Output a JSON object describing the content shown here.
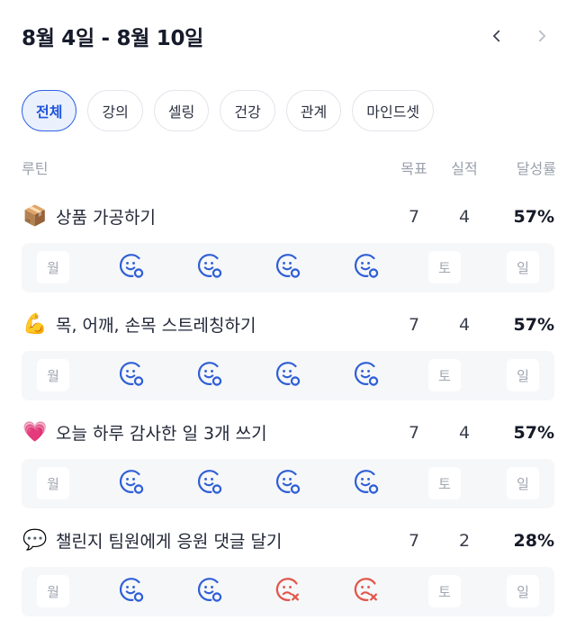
{
  "header": {
    "title": "8월 4일 - 8월 10일"
  },
  "filters": [
    "전체",
    "강의",
    "셀링",
    "건강",
    "관계",
    "마인드셋"
  ],
  "columns": {
    "routine": "루틴",
    "goal": "목표",
    "actual": "실적",
    "rate": "달성률"
  },
  "colors": {
    "accent": "#2f63e6",
    "success": "#2f5fd6",
    "fail": "#e2564a"
  },
  "routines": [
    {
      "emoji": "📦",
      "name": "상품 가공하기",
      "goal": "7",
      "actual": "4",
      "rate": "57%",
      "days": [
        {
          "type": "text",
          "label": "월"
        },
        {
          "type": "success",
          "icon": "smile-check-icon"
        },
        {
          "type": "success",
          "icon": "smile-check-icon"
        },
        {
          "type": "success",
          "icon": "smile-check-icon"
        },
        {
          "type": "success",
          "icon": "smile-check-icon"
        },
        {
          "type": "text",
          "label": "토"
        },
        {
          "type": "text",
          "label": "일"
        }
      ]
    },
    {
      "emoji": "💪",
      "name": "목, 어깨, 손목 스트레칭하기",
      "goal": "7",
      "actual": "4",
      "rate": "57%",
      "days": [
        {
          "type": "text",
          "label": "월"
        },
        {
          "type": "success",
          "icon": "smile-check-icon"
        },
        {
          "type": "success",
          "icon": "smile-check-icon"
        },
        {
          "type": "success",
          "icon": "smile-check-icon"
        },
        {
          "type": "success",
          "icon": "smile-check-icon"
        },
        {
          "type": "text",
          "label": "토"
        },
        {
          "type": "text",
          "label": "일"
        }
      ]
    },
    {
      "emoji": "💗",
      "name": "오늘 하루 감사한 일 3개 쓰기",
      "goal": "7",
      "actual": "4",
      "rate": "57%",
      "days": [
        {
          "type": "text",
          "label": "월"
        },
        {
          "type": "success",
          "icon": "smile-check-icon"
        },
        {
          "type": "success",
          "icon": "smile-check-icon"
        },
        {
          "type": "success",
          "icon": "smile-check-icon"
        },
        {
          "type": "success",
          "icon": "smile-check-icon"
        },
        {
          "type": "text",
          "label": "토"
        },
        {
          "type": "text",
          "label": "일"
        }
      ]
    },
    {
      "emoji": "💬",
      "name": "챌린지 팀원에게 응원 댓글 달기",
      "goal": "7",
      "actual": "2",
      "rate": "28%",
      "days": [
        {
          "type": "text",
          "label": "월"
        },
        {
          "type": "success",
          "icon": "smile-check-icon"
        },
        {
          "type": "success",
          "icon": "smile-check-icon"
        },
        {
          "type": "fail",
          "icon": "sad-x-icon"
        },
        {
          "type": "fail",
          "icon": "sad-x-icon"
        },
        {
          "type": "text",
          "label": "토"
        },
        {
          "type": "text",
          "label": "일"
        }
      ]
    }
  ]
}
